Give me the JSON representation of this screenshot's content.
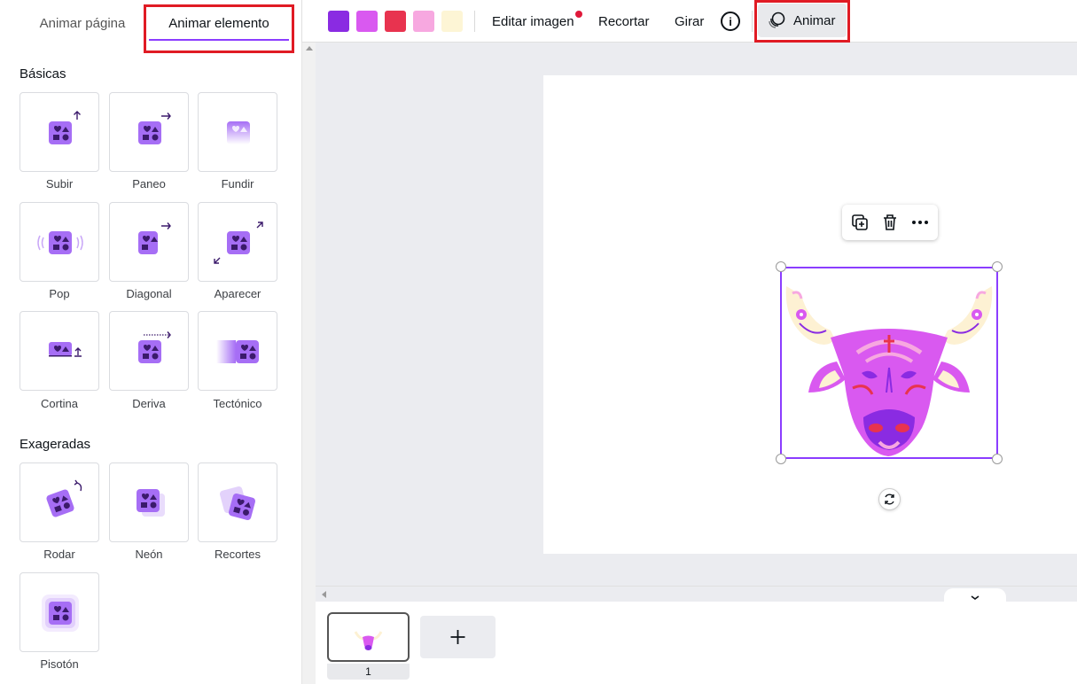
{
  "tabs": {
    "animate_page": "Animar página",
    "animate_element": "Animar elemento"
  },
  "sections": {
    "basic": "Básicas",
    "exaggerated": "Exageradas"
  },
  "basic_animations": [
    "Subir",
    "Paneo",
    "Fundir",
    "Pop",
    "Diagonal",
    "Aparecer",
    "Cortina",
    "Deriva",
    "Tectónico"
  ],
  "exaggerated_animations": [
    "Rodar",
    "Neón",
    "Recortes",
    "Pisotón"
  ],
  "toolbar": {
    "colors": [
      "#8a2be2",
      "#d959f0",
      "#e8334f",
      "#f7a8e0",
      "#fdf5d5"
    ],
    "edit_image": "Editar imagen",
    "crop": "Recortar",
    "rotate": "Girar",
    "info_icon": "i",
    "animate": "Animar"
  },
  "icons": {
    "floating_toolbar": [
      "duplicate-icon",
      "trash-icon",
      "more-icon"
    ],
    "rotate_handle": "rotate-icon",
    "add_page": "plus-icon",
    "collapse": "chevron-down-icon"
  },
  "pages": {
    "current_page_number": "1",
    "add_page_symbol": "+"
  },
  "colors": {
    "accent": "#8b3dff",
    "highlight_box": "#e01b24",
    "notification_dot": "#e0193a"
  }
}
